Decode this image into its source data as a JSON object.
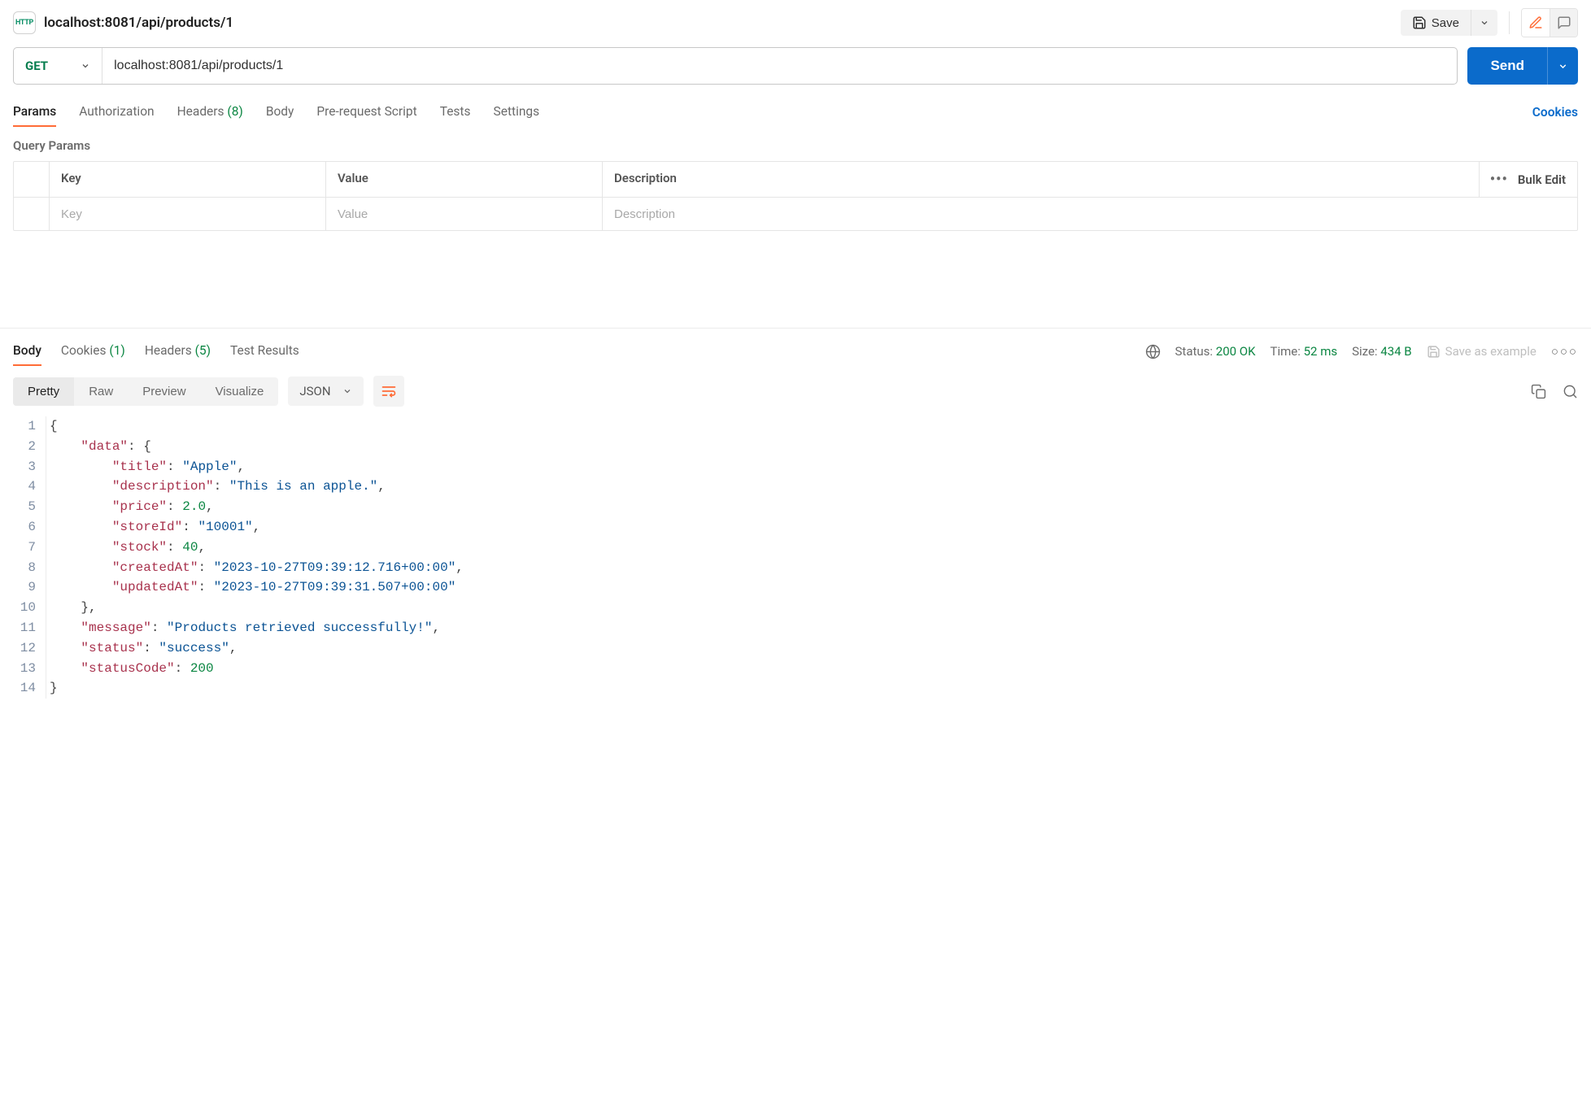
{
  "header": {
    "badge": "HTTP",
    "title": "localhost:8081/api/products/1",
    "save": "Save"
  },
  "request": {
    "method": "GET",
    "url": "localhost:8081/api/products/1",
    "send": "Send"
  },
  "req_tabs": {
    "params": "Params",
    "authorization": "Authorization",
    "headers": "Headers",
    "headers_count": "(8)",
    "body": "Body",
    "pre": "Pre-request Script",
    "tests": "Tests",
    "settings": "Settings",
    "cookies": "Cookies"
  },
  "query_params": {
    "title": "Query Params",
    "key_h": "Key",
    "value_h": "Value",
    "desc_h": "Description",
    "key_ph": "Key",
    "value_ph": "Value",
    "desc_ph": "Description",
    "bulk": "Bulk Edit"
  },
  "resp_tabs": {
    "body": "Body",
    "cookies": "Cookies",
    "cookies_count": "(1)",
    "headers": "Headers",
    "headers_count": "(5)",
    "test_results": "Test Results"
  },
  "resp_meta": {
    "status_label": "Status:",
    "status_value": "200 OK",
    "time_label": "Time:",
    "time_value": "52 ms",
    "size_label": "Size:",
    "size_value": "434 B",
    "save_example": "Save as example"
  },
  "body_toolbar": {
    "pretty": "Pretty",
    "raw": "Raw",
    "preview": "Preview",
    "visualize": "Visualize",
    "lang": "JSON"
  },
  "response_json": {
    "data": {
      "title": "Apple",
      "description": "This is an apple.",
      "price": 2.0,
      "storeId": "10001",
      "stock": 40,
      "createdAt": "2023-10-27T09:39:12.716+00:00",
      "updatedAt": "2023-10-27T09:39:31.507+00:00"
    },
    "message": "Products retrieved successfully!",
    "status": "success",
    "statusCode": 200
  }
}
